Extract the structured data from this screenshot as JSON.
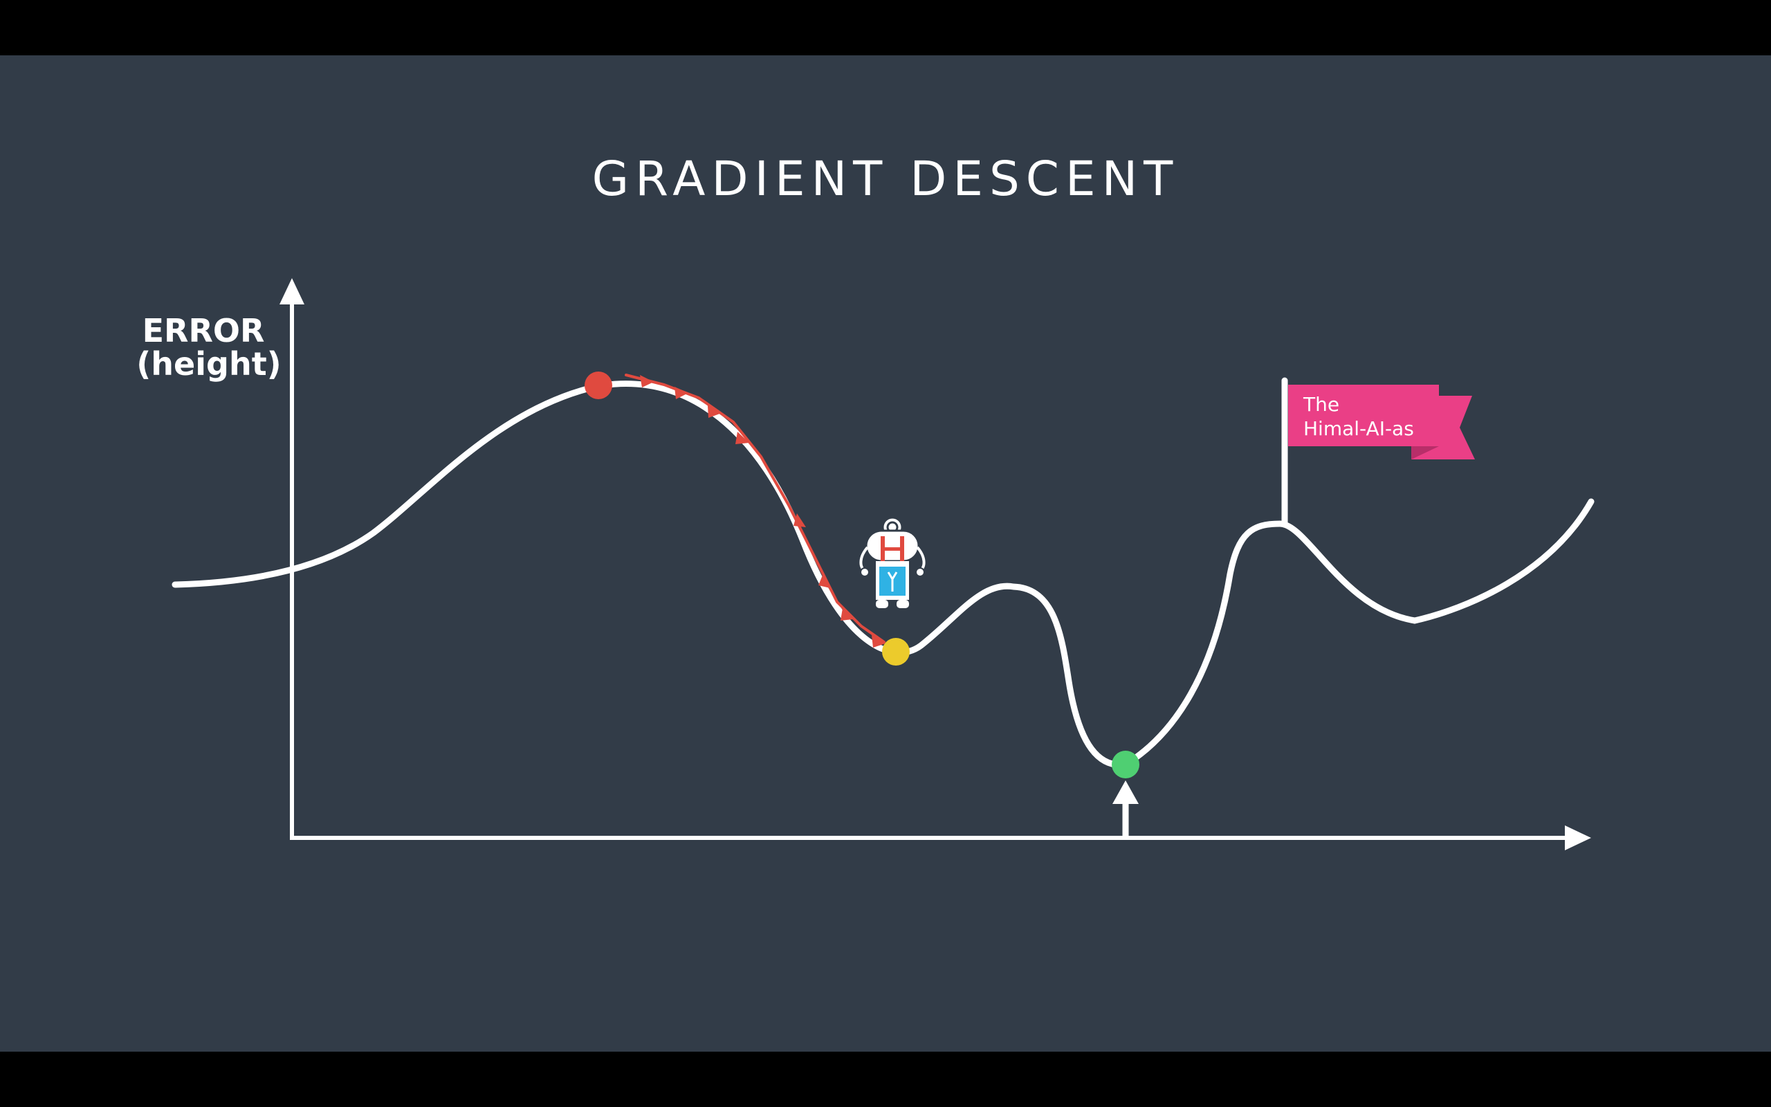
{
  "slide": {
    "title": "GRADIENT DESCENT",
    "y_axis_label_line1": "ERROR",
    "y_axis_label_line2": "(height)",
    "flag_label_line1": "The",
    "flag_label_line2": "Himal-AI-as"
  },
  "colors": {
    "frame": "#000000",
    "background": "#323c48",
    "curve": "#ffffff",
    "start_point": "#e04a3f",
    "local_min_point": "#eccb2c",
    "global_min_point": "#4fcf72",
    "descent_arrows": "#e04a3f",
    "flag": "#ea3f86",
    "flag_shadow": "#b82e69"
  },
  "icons": {
    "character": "astronaut-icon",
    "flag": "flag-icon"
  }
}
